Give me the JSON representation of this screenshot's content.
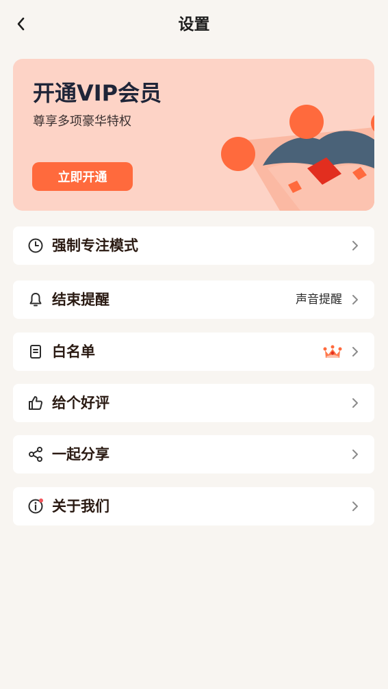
{
  "header": {
    "title": "设置"
  },
  "vip": {
    "title": "开通VIP会员",
    "subtitle": "尊享多项豪华特权",
    "button_label": "立即开通"
  },
  "settings": {
    "items": [
      {
        "label": "强制专注模式",
        "icon": "clock-icon"
      },
      {
        "label": "结束提醒",
        "icon": "bell-icon",
        "value": "声音提醒"
      },
      {
        "label": "白名单",
        "icon": "document-icon",
        "badge": "vip-crown-icon"
      },
      {
        "label": "给个好评",
        "icon": "thumbs-up-icon"
      },
      {
        "label": "一起分享",
        "icon": "share-icon"
      },
      {
        "label": "关于我们",
        "icon": "info-icon",
        "notification_dot": true
      }
    ]
  },
  "colors": {
    "background": "#f8f5f1",
    "vip_card": "#fdd3c6",
    "accent": "#ff6a3d",
    "vip_title": "#1f2538",
    "notification_dot": "#f2545b"
  }
}
